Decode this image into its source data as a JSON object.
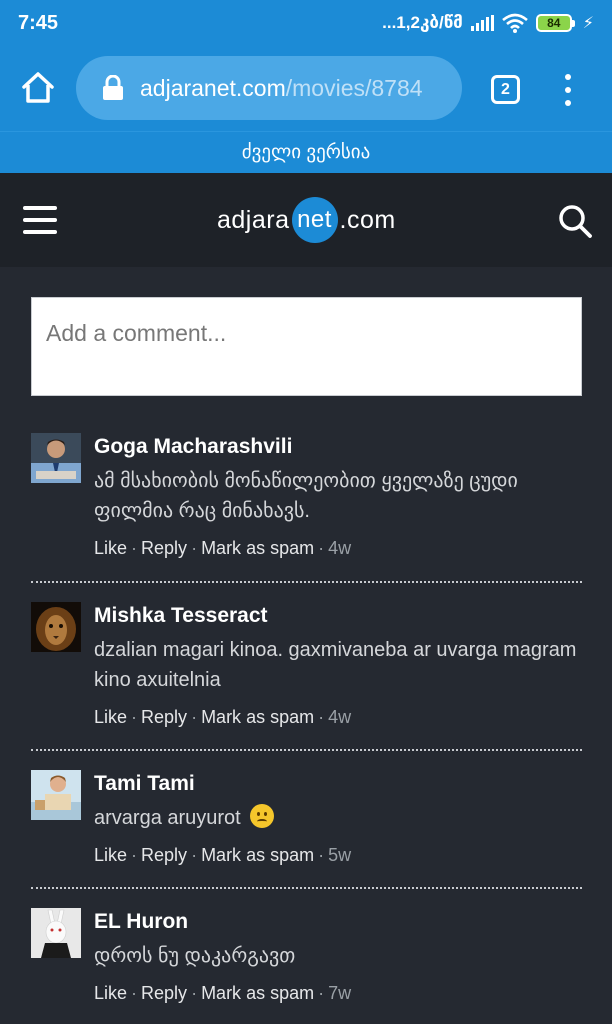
{
  "status_bar": {
    "time": "7:45",
    "network_text": "...1,2კბ/წმ",
    "battery": "84"
  },
  "browser": {
    "url_domain": "adjaranet.com",
    "url_path": "/movies/8784",
    "tab_count": "2"
  },
  "banner": {
    "old_version_label": "ძველი ვერსია"
  },
  "site": {
    "logo_prefix": "adjara",
    "logo_badge": "net",
    "logo_suffix": ".com"
  },
  "comment_box": {
    "placeholder": "Add a comment..."
  },
  "actions": {
    "like": "Like",
    "reply": "Reply",
    "spam": "Mark as spam",
    "separator": "·"
  },
  "comments": [
    {
      "author": "Goga Macharashvili",
      "text": "ამ მსახიობის მონაწილეობით ყველაზე ცუდი ფილმია რაც მინახავს.",
      "age": "4w"
    },
    {
      "author": "Mishka Tesseract",
      "text": "dzalian magari kinoa. gaxmivaneba ar uvarga magram kino axuitelnia",
      "age": "4w"
    },
    {
      "author": "Tami Tami",
      "text": "arvarga aruyurot",
      "age": "5w"
    },
    {
      "author": "EL Huron",
      "text": "დროს ნუ დაკარგავთ",
      "age": "7w"
    }
  ],
  "colors": {
    "brand_blue": "#1c8bd6",
    "page_bg": "#252931",
    "header_bg": "#1e2228"
  }
}
